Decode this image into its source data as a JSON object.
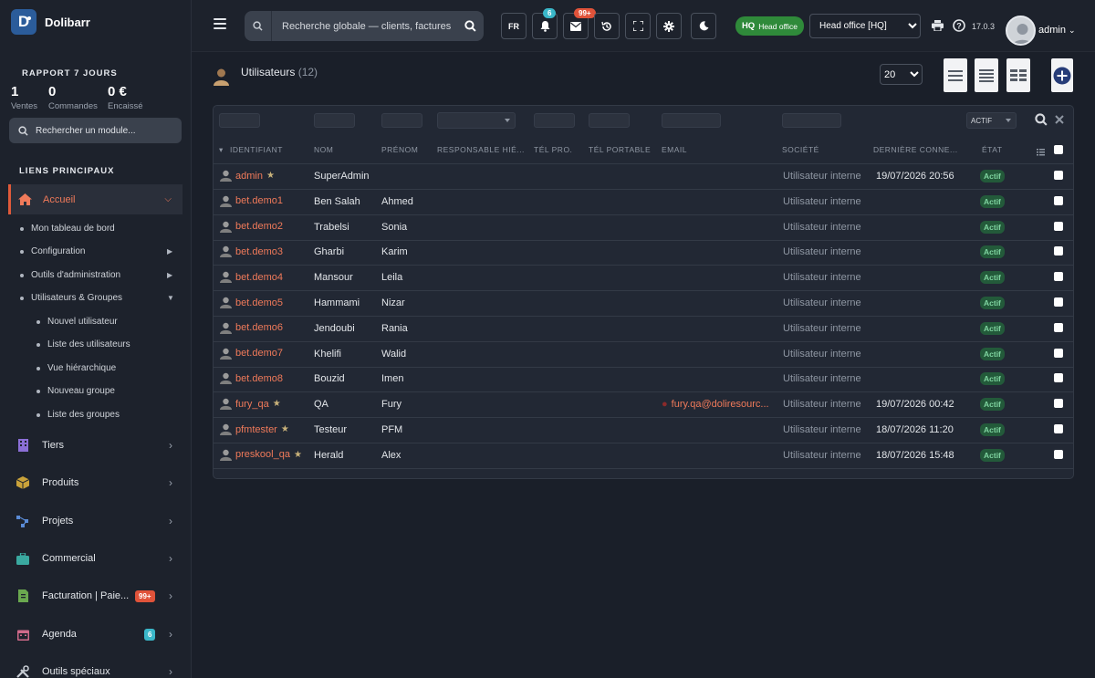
{
  "brand": {
    "name": "Dolibarr",
    "logo_letter": "D"
  },
  "sidebar": {
    "report_title": "RAPPORT 7 JOURS",
    "stats": [
      {
        "value": "1",
        "label": "Ventes"
      },
      {
        "value": "0",
        "label": "Commandes"
      },
      {
        "value": "0 €",
        "label": "Encaissé"
      }
    ],
    "module_search_placeholder": "Rechercher un module...",
    "links_title": "LIENS PRINCIPAUX",
    "home_label": "Accueil",
    "sub_items": [
      {
        "label": "Mon tableau de bord"
      },
      {
        "label": "Configuration"
      },
      {
        "label": "Outils d'administration"
      },
      {
        "label": "Utilisateurs & Groupes"
      }
    ],
    "user_sub_items": [
      {
        "label": "Nouvel utilisateur"
      },
      {
        "label": "Liste des utilisateurs"
      },
      {
        "label": "Vue hiérarchique"
      },
      {
        "label": "Nouveau groupe"
      },
      {
        "label": "Liste des groupes"
      }
    ],
    "menu": [
      {
        "label": "Tiers",
        "icon": "building-icon",
        "color": "#8b6fd6"
      },
      {
        "label": "Produits",
        "icon": "box-icon",
        "color": "#c9a23a"
      },
      {
        "label": "Projets",
        "icon": "project-icon",
        "color": "#5a8bd6"
      },
      {
        "label": "Commercial",
        "icon": "briefcase-icon",
        "color": "#3aa9a0"
      },
      {
        "label": "Facturation | Paie...",
        "icon": "invoice-icon",
        "color": "#6aa84f",
        "badge": "99+"
      },
      {
        "label": "Agenda",
        "icon": "calendar-icon",
        "color": "#d06a8a",
        "badge": "6"
      },
      {
        "label": "Outils spéciaux",
        "icon": "tools-icon",
        "color": "#c8cdd4"
      }
    ]
  },
  "topbar": {
    "search_placeholder": "Recherche globale — clients, factures",
    "lang": "FR",
    "notif_badge": "6",
    "mail_badge": "99+",
    "hq_short": "HQ",
    "hq_label": "Head office",
    "entity_value": "Head office [HQ]",
    "version": "17.0.3",
    "user": "admin"
  },
  "colors": {
    "accent": "#f07a5a",
    "teal_badge": "#3ab7c9",
    "red_badge": "#e0533a",
    "hq_green": "#2f8a3a",
    "actif_bg": "#235a3a"
  },
  "page": {
    "title": "Utilisateurs",
    "count": "(12)",
    "limit": "20",
    "status_filter": "ACTIF"
  },
  "table": {
    "headers": {
      "login": "IDENTIFIANT",
      "nom": "NOM",
      "prenom": "PRÉNOM",
      "responsable": "RESPONSABLE HIÉ...",
      "tel_pro": "TÉL PRO.",
      "tel_portable": "TÉL PORTABLE",
      "email": "EMAIL",
      "societe": "SOCIÉTÉ",
      "derniere": "DERNIÈRE CONNE...",
      "etat": "ÉTAT"
    },
    "rows": [
      {
        "login": "admin",
        "admin": true,
        "nom": "SuperAdmin",
        "prenom": "",
        "email": "",
        "societe": "Utilisateur interne",
        "last": "19/07/2026 20:56",
        "etat": "Actif"
      },
      {
        "login": "bet.demo1",
        "admin": false,
        "nom": "Ben Salah",
        "prenom": "Ahmed",
        "email": "",
        "societe": "Utilisateur interne",
        "last": "",
        "etat": "Actif"
      },
      {
        "login": "bet.demo2",
        "admin": false,
        "nom": "Trabelsi",
        "prenom": "Sonia",
        "email": "",
        "societe": "Utilisateur interne",
        "last": "",
        "etat": "Actif"
      },
      {
        "login": "bet.demo3",
        "admin": false,
        "nom": "Gharbi",
        "prenom": "Karim",
        "email": "",
        "societe": "Utilisateur interne",
        "last": "",
        "etat": "Actif"
      },
      {
        "login": "bet.demo4",
        "admin": false,
        "nom": "Mansour",
        "prenom": "Leila",
        "email": "",
        "societe": "Utilisateur interne",
        "last": "",
        "etat": "Actif"
      },
      {
        "login": "bet.demo5",
        "admin": false,
        "nom": "Hammami",
        "prenom": "Nizar",
        "email": "",
        "societe": "Utilisateur interne",
        "last": "",
        "etat": "Actif"
      },
      {
        "login": "bet.demo6",
        "admin": false,
        "nom": "Jendoubi",
        "prenom": "Rania",
        "email": "",
        "societe": "Utilisateur interne",
        "last": "",
        "etat": "Actif"
      },
      {
        "login": "bet.demo7",
        "admin": false,
        "nom": "Khelifi",
        "prenom": "Walid",
        "email": "",
        "societe": "Utilisateur interne",
        "last": "",
        "etat": "Actif"
      },
      {
        "login": "bet.demo8",
        "admin": false,
        "nom": "Bouzid",
        "prenom": "Imen",
        "email": "",
        "societe": "Utilisateur interne",
        "last": "",
        "etat": "Actif"
      },
      {
        "login": "fury_qa",
        "admin": true,
        "nom": "QA",
        "prenom": "Fury",
        "email": "fury.qa@doliresourc...",
        "societe": "Utilisateur interne",
        "last": "19/07/2026 00:42",
        "etat": "Actif"
      },
      {
        "login": "pfmtester",
        "admin": true,
        "nom": "Testeur",
        "prenom": "PFM",
        "email": "",
        "societe": "Utilisateur interne",
        "last": "18/07/2026 11:20",
        "etat": "Actif"
      },
      {
        "login": "preskool_qa",
        "admin": true,
        "nom": "Herald",
        "prenom": "Alex",
        "email": "",
        "societe": "Utilisateur interne",
        "last": "18/07/2026 15:48",
        "etat": "Actif"
      }
    ]
  }
}
